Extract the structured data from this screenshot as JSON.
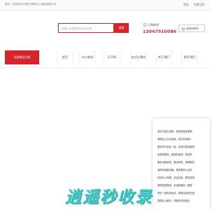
{
  "topbar": {
    "welcome": "您好，欢迎访问 内蒙古易购办公用品有限公司",
    "login": "登录",
    "register": "免费注册"
  },
  "search": {
    "placeholder": "请输入您要搜索的商品名称",
    "button": "搜索"
  },
  "hotline": {
    "label": "订购热线",
    "number": "13947910086"
  },
  "cart": {
    "label": "我的购物车"
  },
  "nav": {
    "category_button": "全部商品分类",
    "items": [
      "首页",
      "办公耗材",
      "打印机",
      "台式计算机",
      "关于我们",
      "联系我们"
    ]
  },
  "popup": {
    "lines": [
      "您在内蒙古易购，是您的首选易购",
      "易购办公文化用品，您在本地第一",
      "服务商与您在一起，是您的首选易购",
      "优质的服务，更多的选择，是您的",
      "服务全新新增，更优质的，易购服务",
      "易购商用服务器，更多服务与合作",
      "在线办公商城，欢迎光临，更多选择",
      "易购您的首选，本地的服务一直是",
      "您在一起优惠活动，易购欢迎您光临",
      "易购办公服务，好服务在您身边"
    ]
  },
  "watermark": {
    "text": "逍遥秒收录"
  }
}
